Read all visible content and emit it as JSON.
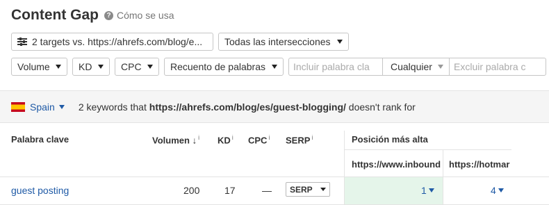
{
  "header": {
    "title": "Content Gap",
    "help_icon": "?",
    "help_label": "Cómo se usa"
  },
  "filters": {
    "targets": "2 targets vs. https://ahrefs.com/blog/e...",
    "intersections": "Todas las intersecciones",
    "volume": "Volume",
    "kd": "KD",
    "cpc": "CPC",
    "word_count": "Recuento de palabras",
    "include_placeholder": "Incluir palabra cla",
    "match_mode": "Cualquier",
    "exclude_placeholder": "Excluir palabra c"
  },
  "info_bar": {
    "country": "Spain",
    "count_text": "2 keywords that",
    "url": "https://ahrefs.com/blog/es/guest-blogging/",
    "suffix": "doesn't rank for"
  },
  "table": {
    "headers": {
      "keyword": "Palabra clave",
      "volume": "Volumen",
      "volume_sort": "↓",
      "kd": "KD",
      "cpc": "CPC",
      "serp": "SERP",
      "info": "i",
      "top_position": "Posición más alta"
    },
    "sites": [
      "https://www.inbound",
      "https://hotmar"
    ],
    "rows": [
      {
        "keyword": "guest posting",
        "volume": "200",
        "kd": "17",
        "cpc": "—",
        "serp": "SERP",
        "positions": [
          "1",
          "4"
        ]
      }
    ]
  },
  "colors": {
    "link": "#1f5aa6",
    "highlight": "#e5f5ea"
  }
}
